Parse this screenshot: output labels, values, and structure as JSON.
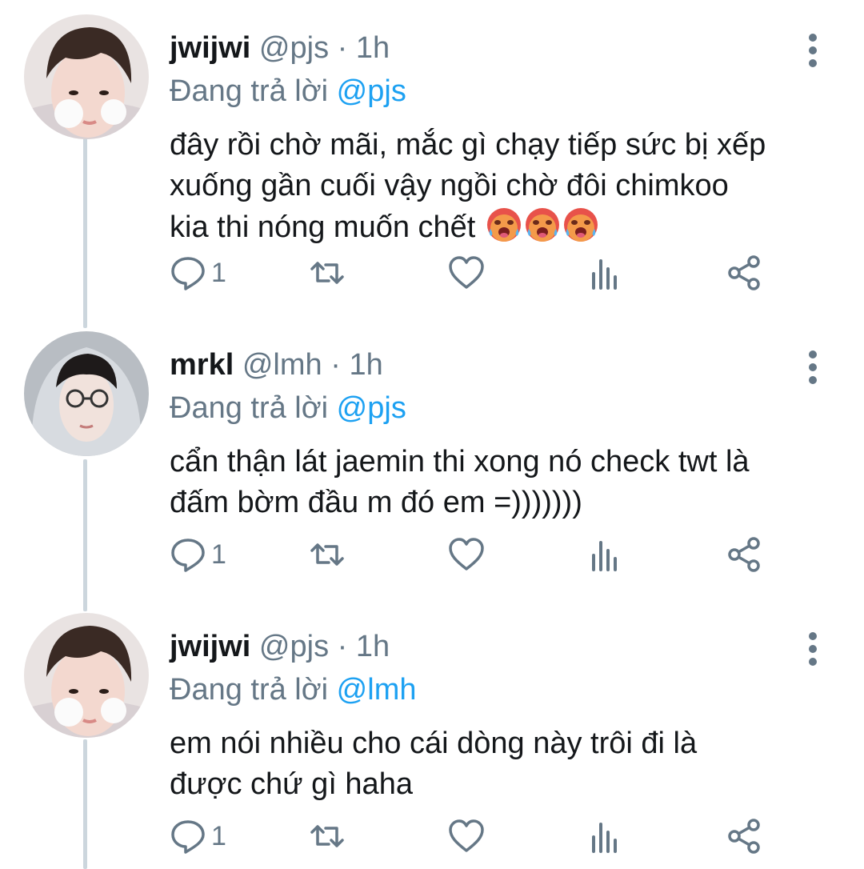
{
  "tweets": [
    {
      "name": "jwijwi",
      "handle": "@pjs",
      "separator": "·",
      "time": "1h",
      "reply_prefix": "Đang trả lời",
      "reply_to": "@pjs",
      "body_lines": [
        "đây rồi chờ mãi, mắc gì chạy tiếp sức bị xếp",
        "xuống gần cuối vậy ngồi chờ đôi chimkoo",
        "kia thi nóng muốn chết"
      ],
      "emojis": [
        "hot-face-emoji",
        "hot-face-emoji",
        "hot-face-emoji"
      ],
      "reply_count": "1",
      "avatar": "jwijwi-avatar"
    },
    {
      "name": "mrkl",
      "handle": "@lmh",
      "separator": "·",
      "time": "1h",
      "reply_prefix": "Đang trả lời",
      "reply_to": "@pjs",
      "body_lines": [
        "cẩn thận lát jaemin thi xong nó check twt là",
        "đấm bờm đầu m đó em =)))))))"
      ],
      "emojis": [],
      "reply_count": "1",
      "avatar": "mrkl-avatar"
    },
    {
      "name": "jwijwi",
      "handle": "@pjs",
      "separator": "·",
      "time": "1h",
      "reply_prefix": "Đang trả lời",
      "reply_to": "@lmh",
      "body_lines": [
        "em nói nhiều cho cái dòng này trôi đi là",
        "được chứ gì haha"
      ],
      "emojis": [],
      "reply_count": "1",
      "avatar": "jwijwi-avatar"
    }
  ],
  "colors": {
    "text": "#14171a",
    "secondary": "#657786",
    "mention": "#1da1f2",
    "thread_line": "#ccd6dd"
  },
  "icons": [
    "reply-icon",
    "retweet-icon",
    "like-icon",
    "analytics-icon",
    "share-icon",
    "more-options-icon"
  ]
}
